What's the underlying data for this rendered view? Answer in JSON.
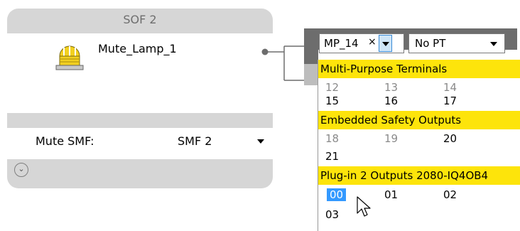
{
  "sof_block": {
    "title": "SOF 2",
    "device_name": "Mute_Lamp_1",
    "param_label": "Mute SMF:",
    "param_value": "SMF 2"
  },
  "terminal_box": {
    "selected_terminal": "MP_14",
    "clear_glyph": "×",
    "pt_value": "No PT"
  },
  "dropdown": {
    "sections": [
      {
        "header": "Multi-Purpose Terminals",
        "items": [
          {
            "label": "12",
            "enabled": false
          },
          {
            "label": "13",
            "enabled": false
          },
          {
            "label": "14",
            "enabled": false
          },
          {
            "label": "15",
            "enabled": true
          },
          {
            "label": "16",
            "enabled": true
          },
          {
            "label": "17",
            "enabled": true
          }
        ]
      },
      {
        "header": "Embedded Safety Outputs",
        "items": [
          {
            "label": "18",
            "enabled": false
          },
          {
            "label": "19",
            "enabled": false
          },
          {
            "label": "20",
            "enabled": true
          },
          {
            "label": "21",
            "enabled": true
          }
        ]
      },
      {
        "header": "Plug-in 2 Outputs 2080-IQ4OB4",
        "items": [
          {
            "label": "00",
            "enabled": true,
            "selected": true
          },
          {
            "label": "01",
            "enabled": true
          },
          {
            "label": "02",
            "enabled": true
          },
          {
            "label": "03",
            "enabled": true
          }
        ]
      }
    ]
  },
  "colors": {
    "section_header": "#fde40b",
    "selection": "#3399ff",
    "block_gray": "#d6d6d6",
    "box_gray": "#6d6d6d"
  },
  "icons": [
    "lamp-icon",
    "expand-chevron-icon",
    "clear-icon",
    "dropdown-arrow-icon",
    "mouse-pointer-icon"
  ]
}
